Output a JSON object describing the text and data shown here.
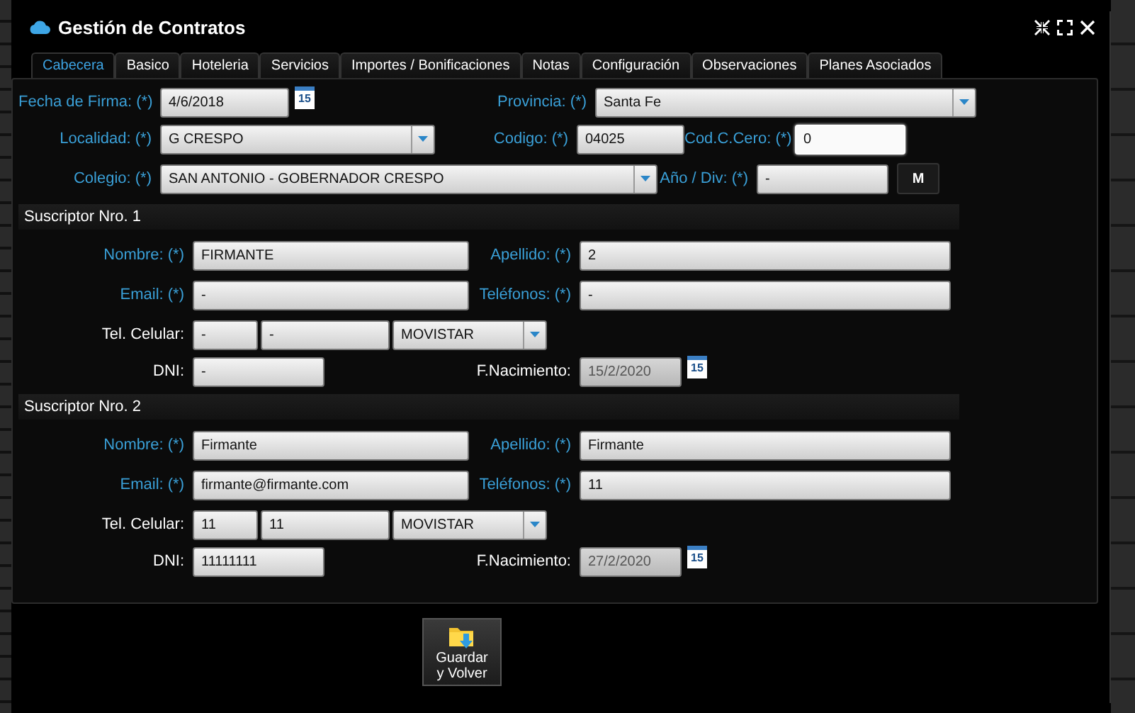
{
  "window": {
    "title": "Gestión de Contratos"
  },
  "tabs": [
    {
      "label": "Cabecera",
      "selected": true
    },
    {
      "label": "Basico",
      "selected": false
    },
    {
      "label": "Hoteleria",
      "selected": false
    },
    {
      "label": "Servicios",
      "selected": false
    },
    {
      "label": "Importes / Bonificaciones",
      "selected": false
    },
    {
      "label": "Notas",
      "selected": false
    },
    {
      "label": "Configuración",
      "selected": false
    },
    {
      "label": "Observaciones",
      "selected": false
    },
    {
      "label": "Planes Asociados",
      "selected": false
    }
  ],
  "header": {
    "fecha_firma": {
      "label": "Fecha de Firma: (*)",
      "value": "4/6/2018",
      "required": true,
      "calendar": "15"
    },
    "provincia": {
      "label": "Provincia: (*)",
      "value": "Santa Fe",
      "required": true
    },
    "localidad": {
      "label": "Localidad: (*)",
      "value": "G CRESPO",
      "required": true
    },
    "codigo": {
      "label": "Codigo: (*)",
      "value": "04025",
      "required": true,
      "focused": false
    },
    "cod_cero": {
      "label": "Cod.C.Cero: (*)",
      "value": "0",
      "required": true,
      "focused": true
    },
    "colegio": {
      "label": "Colegio: (*)",
      "value": "SAN ANTONIO - GOBERNADOR CRESPO",
      "required": true
    },
    "anio_div": {
      "label": "Año / Div: (*)",
      "value": "-",
      "required": true,
      "focused": false
    },
    "m_button": "M"
  },
  "subscribers": [
    {
      "title": "Suscriptor Nro. 1",
      "nombre": {
        "label": "Nombre: (*)",
        "value": "FIRMANTE",
        "required": true
      },
      "apellido": {
        "label": "Apellido: (*)",
        "value": "2",
        "required": true
      },
      "email": {
        "label": "Email: (*)",
        "value": "-",
        "required": true
      },
      "telefonos": {
        "label": "Teléfonos: (*)",
        "value": "-",
        "required": true
      },
      "celular": {
        "label": "Tel. Celular:",
        "area": "-",
        "number": "-",
        "carrier": "MOVISTAR",
        "required": false
      },
      "dni": {
        "label": "DNI:",
        "value": "-",
        "required": false
      },
      "nacimiento": {
        "label": "F.Nacimiento:",
        "value": "15/2/2020",
        "required": false,
        "disabled": true,
        "calendar": "15"
      }
    },
    {
      "title": "Suscriptor Nro. 2",
      "nombre": {
        "label": "Nombre: (*)",
        "value": "Firmante",
        "required": true
      },
      "apellido": {
        "label": "Apellido: (*)",
        "value": "Firmante",
        "required": true
      },
      "email": {
        "label": "Email: (*)",
        "value": "firmante@firmante.com",
        "required": true
      },
      "telefonos": {
        "label": "Teléfonos: (*)",
        "value": "11",
        "required": true
      },
      "celular": {
        "label": "Tel. Celular:",
        "area": "11",
        "number": "11",
        "carrier": "MOVISTAR",
        "required": false
      },
      "dni": {
        "label": "DNI:",
        "value": "11111111",
        "required": false
      },
      "nacimiento": {
        "label": "F.Nacimiento:",
        "value": "27/2/2020",
        "required": false,
        "disabled": true,
        "calendar": "15"
      }
    }
  ],
  "save_button": {
    "line1": "Guardar",
    "line2": "y Volver"
  }
}
